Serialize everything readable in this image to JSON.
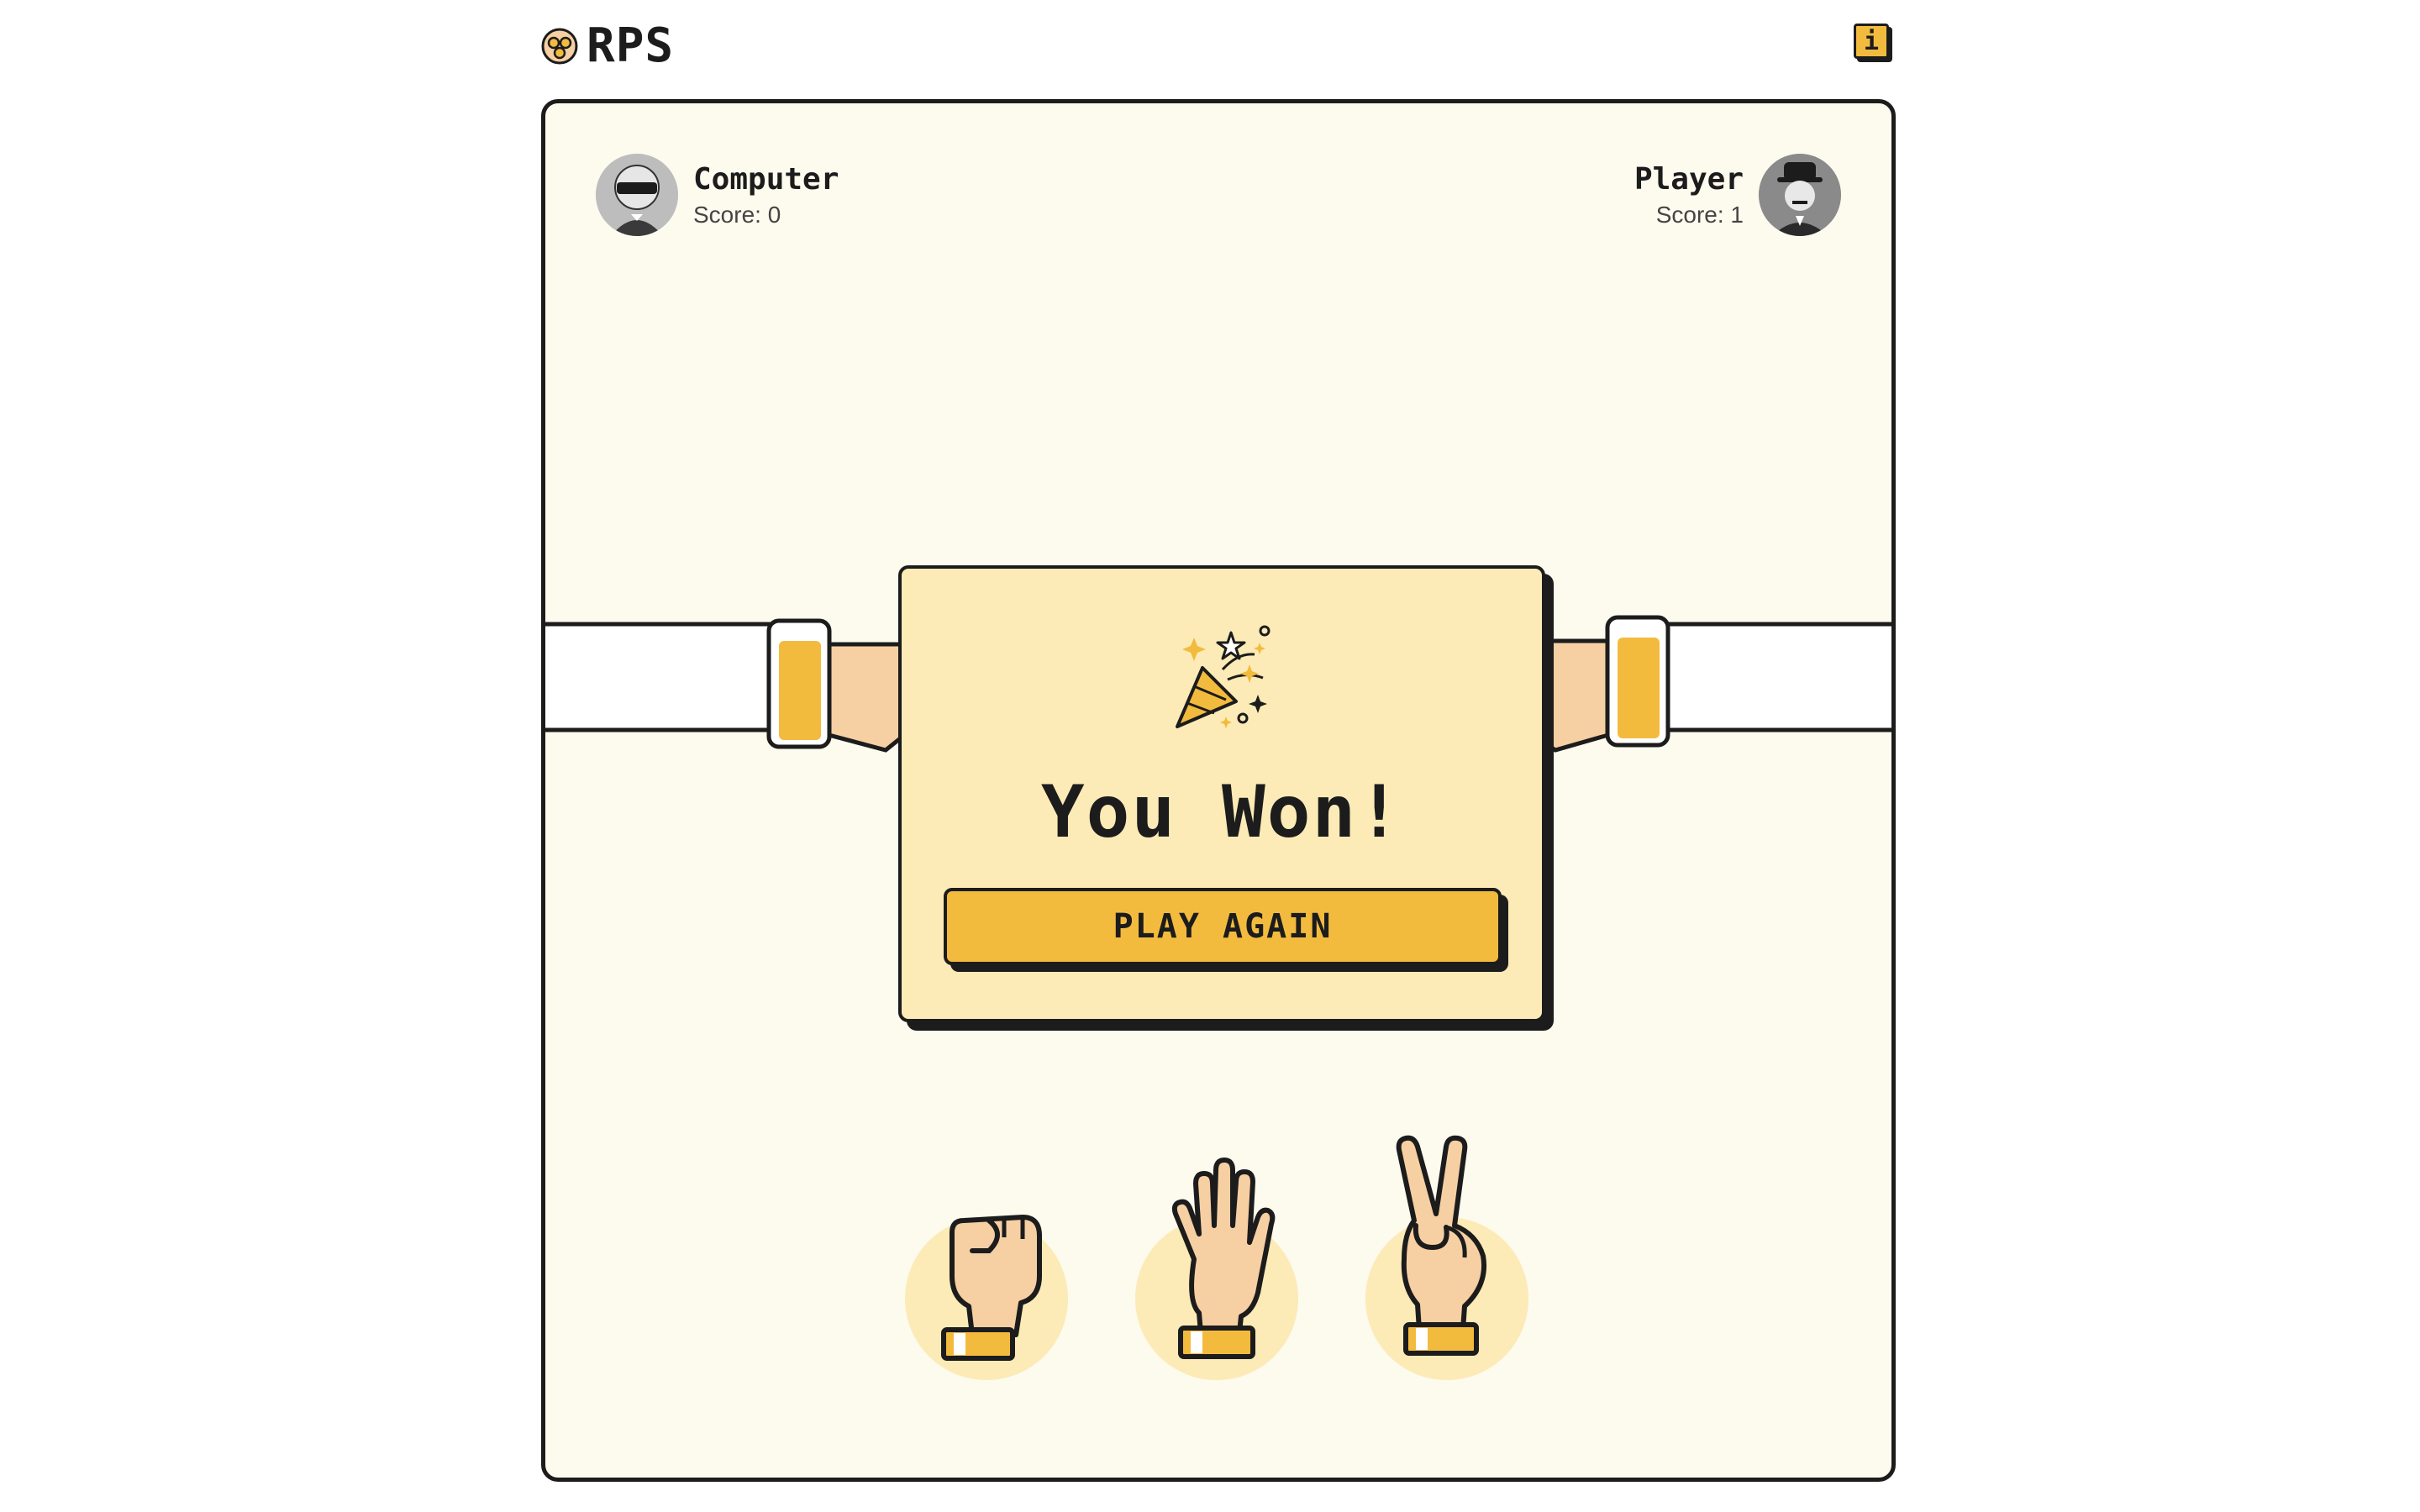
{
  "header": {
    "logo_text": "RPS",
    "logo_icon": "rock-paper-scissors-hands-icon",
    "info_icon": "info-icon",
    "info_label": "i"
  },
  "players": {
    "computer": {
      "name": "Computer",
      "score_text": "Score: 0",
      "avatar": "robot-avatar"
    },
    "player": {
      "name": "Player",
      "score_text": "Score: 1",
      "avatar": "gentleman-avatar"
    }
  },
  "modal": {
    "icon": "party-popper-icon",
    "result": "You Won!",
    "button": "PLAY AGAIN"
  },
  "choices": [
    {
      "id": "rock",
      "icon": "fist-icon"
    },
    {
      "id": "paper",
      "icon": "open-hand-icon"
    },
    {
      "id": "scissors",
      "icon": "peace-hand-icon"
    }
  ],
  "colors": {
    "accent": "#f3bb3e",
    "board_bg": "#fdfaee",
    "modal_bg": "#fcebb6",
    "skin": "#f6cfa3",
    "outline": "#1c1c1c"
  }
}
